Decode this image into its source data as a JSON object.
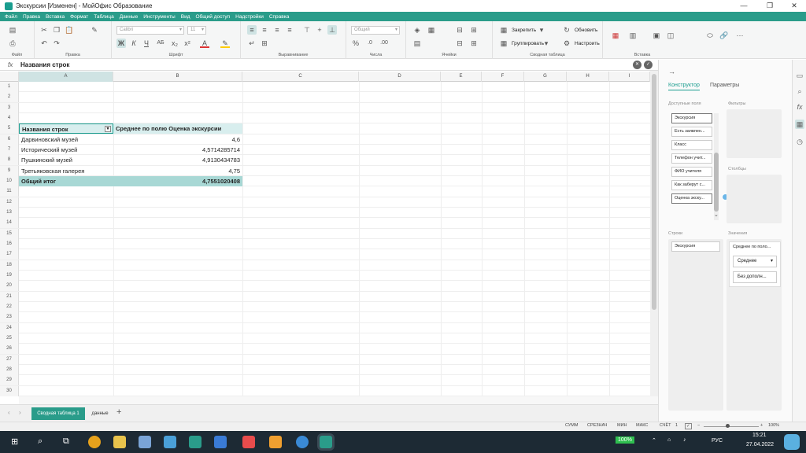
{
  "window": {
    "title": "Экскурсии [Изменен] - МойОфис Образование",
    "min": "—",
    "max": "❐",
    "close": "✕"
  },
  "menu": [
    "Файл",
    "Правка",
    "Вставка",
    "Формат",
    "Таблица",
    "Данные",
    "Инструменты",
    "Вид",
    "Общий доступ",
    "Надстройки",
    "Справка"
  ],
  "ribbon": {
    "groups": [
      "Файл",
      "Правка",
      "Шрифт",
      "Выравнивание",
      "Числа",
      "Ячейки",
      "Сводная таблица",
      "Вставка"
    ],
    "font_name": "Calibri",
    "font_size": "11",
    "number_format": "Общий",
    "freeze_label": "Закрепить",
    "group_label": "Группировать",
    "refresh_label": "Обновить",
    "settings_label": "Настроить"
  },
  "formula_bar": {
    "fx": "fx",
    "value": "Названия строк"
  },
  "columns": [
    "A",
    "B",
    "C",
    "D",
    "E",
    "F",
    "G",
    "H",
    "I"
  ],
  "row_numbers": [
    "1",
    "2",
    "3",
    "4",
    "5",
    "6",
    "7",
    "8",
    "9",
    "10",
    "11",
    "12",
    "13",
    "14",
    "15",
    "16",
    "17",
    "18",
    "19",
    "20",
    "21",
    "22",
    "23",
    "24",
    "25",
    "26",
    "27",
    "28",
    "29",
    "30"
  ],
  "pivot": {
    "header_a": "Названия строк",
    "header_b": "Среднее по полю Оценка экскурсии",
    "rows": [
      {
        "name": "Дарвиновский музей",
        "value": "4,6"
      },
      {
        "name": "Исторический музей",
        "value": "4,5714285714"
      },
      {
        "name": "Пушкинский музей",
        "value": "4,9130434783"
      },
      {
        "name": "Третьяковская галерея",
        "value": "4,75"
      }
    ],
    "total_label": "Общий итог",
    "total_value": "4,7551020408"
  },
  "sheet_tabs": {
    "active": "Сводная таблица 1",
    "other": "данные",
    "add": "+"
  },
  "panel": {
    "tab_constructor": "Конструктор",
    "tab_params": "Параметры",
    "available_fields_label": "Доступные поля",
    "filters_label": "Фильтры",
    "columns_label": "Столбцы",
    "rows_label": "Строки",
    "values_label": "Значения",
    "fields": [
      "Экскурсия",
      "Есть заявлен...",
      "Класс",
      "Телефон учит...",
      "ФИО учителя",
      "Как заберут с...",
      "Оценка экску..."
    ],
    "row_field": "Экскурсия",
    "value_field": "Среднее по поло...",
    "agg": "Среднее",
    "calc": "Без дополн..."
  },
  "status": {
    "sum": "СУММ",
    "avg": "СРЕЗНАЧ",
    "zoom": "100%",
    "min": "МИН",
    "max": "МАКС",
    "count": "СЧЁТ",
    "count_val": "1"
  },
  "taskbar": {
    "time": "15:21",
    "date": "27.04.2022",
    "lang": "РУС",
    "battery": "100%"
  }
}
